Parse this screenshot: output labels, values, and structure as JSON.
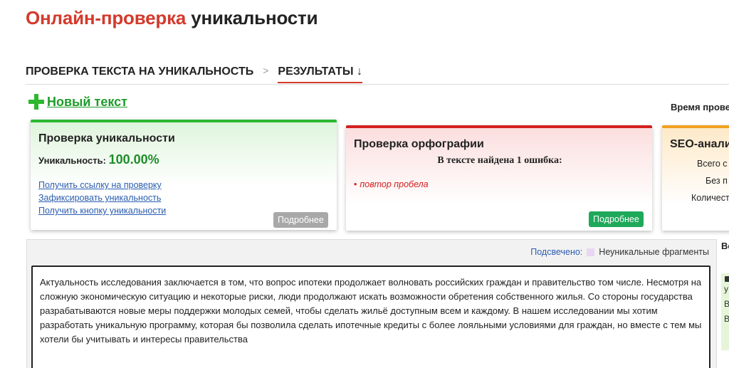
{
  "page": {
    "title_red": "Онлайн-проверка",
    "title_dark": "уникальности"
  },
  "breadcrumbs": {
    "step1": "ПРОВЕРКА ТЕКСТА НА УНИКАЛЬНОСТЬ",
    "separator": ">",
    "step2": "РЕЗУЛЬТАТЫ ↓"
  },
  "new_text": {
    "label": "Новый текст"
  },
  "time_label": "Время прове",
  "uniqueness_card": {
    "title": "Проверка уникальности",
    "label": "Уникальность:",
    "value": "100.00%",
    "links": [
      "Получить ссылку на проверку",
      "Зафиксировать уникальность",
      "Получить кнопку уникальности"
    ],
    "more_button": "Подробнее",
    "accent": "#2db830"
  },
  "spelling_card": {
    "title": "Проверка орфографии",
    "summary": "В тексте найдена 1 ошибка:",
    "errors": [
      "повтор пробела"
    ],
    "more_button": "Подробнее",
    "accent": "#d32020"
  },
  "seo_card": {
    "title": "SEO-анали",
    "lines": [
      "Всего с",
      "Без п",
      "Количест"
    ],
    "accent": "#f0a020"
  },
  "text_panel": {
    "legend_label": "Подсвечено:",
    "legend_text": "Неуникальные фрагменты",
    "content": "Актуальность исследования заключается в том, что вопрос ипотеки продолжает волновать российских граждан и правительство  том числе. Несмотря на сложную экономическую ситуацию и некоторые риски, люди продолжают искать возможности обретения собственного жилья. Со стороны государства разрабатываются новые меры поддержки молодых семей, чтобы сделать жильё доступным всем и каждому. В нашем исследовании мы хотим разработать уникальную программу, которая бы позволила сделать ипотечные кредиты с более лояльными условиями для граждан, но вместе с тем мы хотели бы учитывать и интересы правительства"
  },
  "side_panel": {
    "tab_label": "Ве",
    "lines": [
      "у",
      "В",
      "В"
    ]
  }
}
